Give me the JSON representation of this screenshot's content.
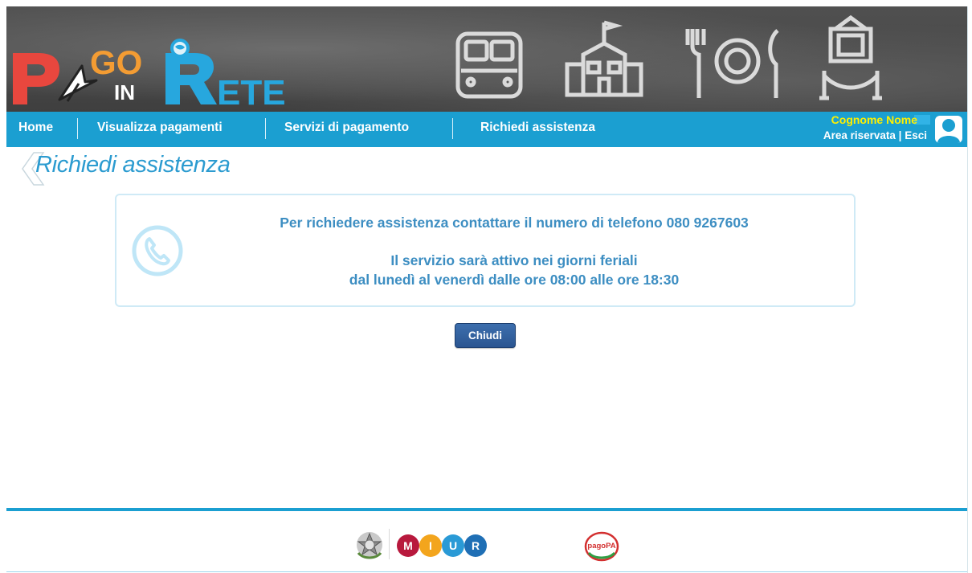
{
  "brand": {
    "logo_pago": "GO",
    "logo_in": "IN",
    "logo_rete": "ETE",
    "colors": {
      "red": "#e8473e",
      "orange": "#f39c33",
      "blue": "#27a7de",
      "nav": "#1b9fd1",
      "title": "#2b9bd0",
      "info_text": "#3d8ec2",
      "user_name": "#fff000"
    },
    "chalk_icons": [
      "bus-icon",
      "school-icon",
      "cafeteria-icon",
      "museum-icon"
    ]
  },
  "nav": {
    "items": [
      {
        "label": "Home"
      },
      {
        "label": "Visualizza pagamenti"
      },
      {
        "label": "Servizi di pagamento"
      },
      {
        "label": "Richiedi assistenza"
      }
    ],
    "user": {
      "name": "Cognome Nome",
      "area_link": "Area riservata",
      "separator": "|",
      "logout_link": "Esci"
    }
  },
  "page": {
    "title": "Richiedi assistenza"
  },
  "info": {
    "line1": "Per richiedere assistenza contattare il numero di telefono 080 9267603",
    "line2": "Il servizio sarà attivo nei giorni feriali",
    "line3": "dal lunedì al venerdì dalle ore 08:00 alle ore 18:30"
  },
  "actions": {
    "close_label": "Chiudi"
  },
  "footer": {
    "miur_letters": [
      "M",
      "I",
      "U",
      "R"
    ],
    "pagopa": "pagoPA"
  }
}
